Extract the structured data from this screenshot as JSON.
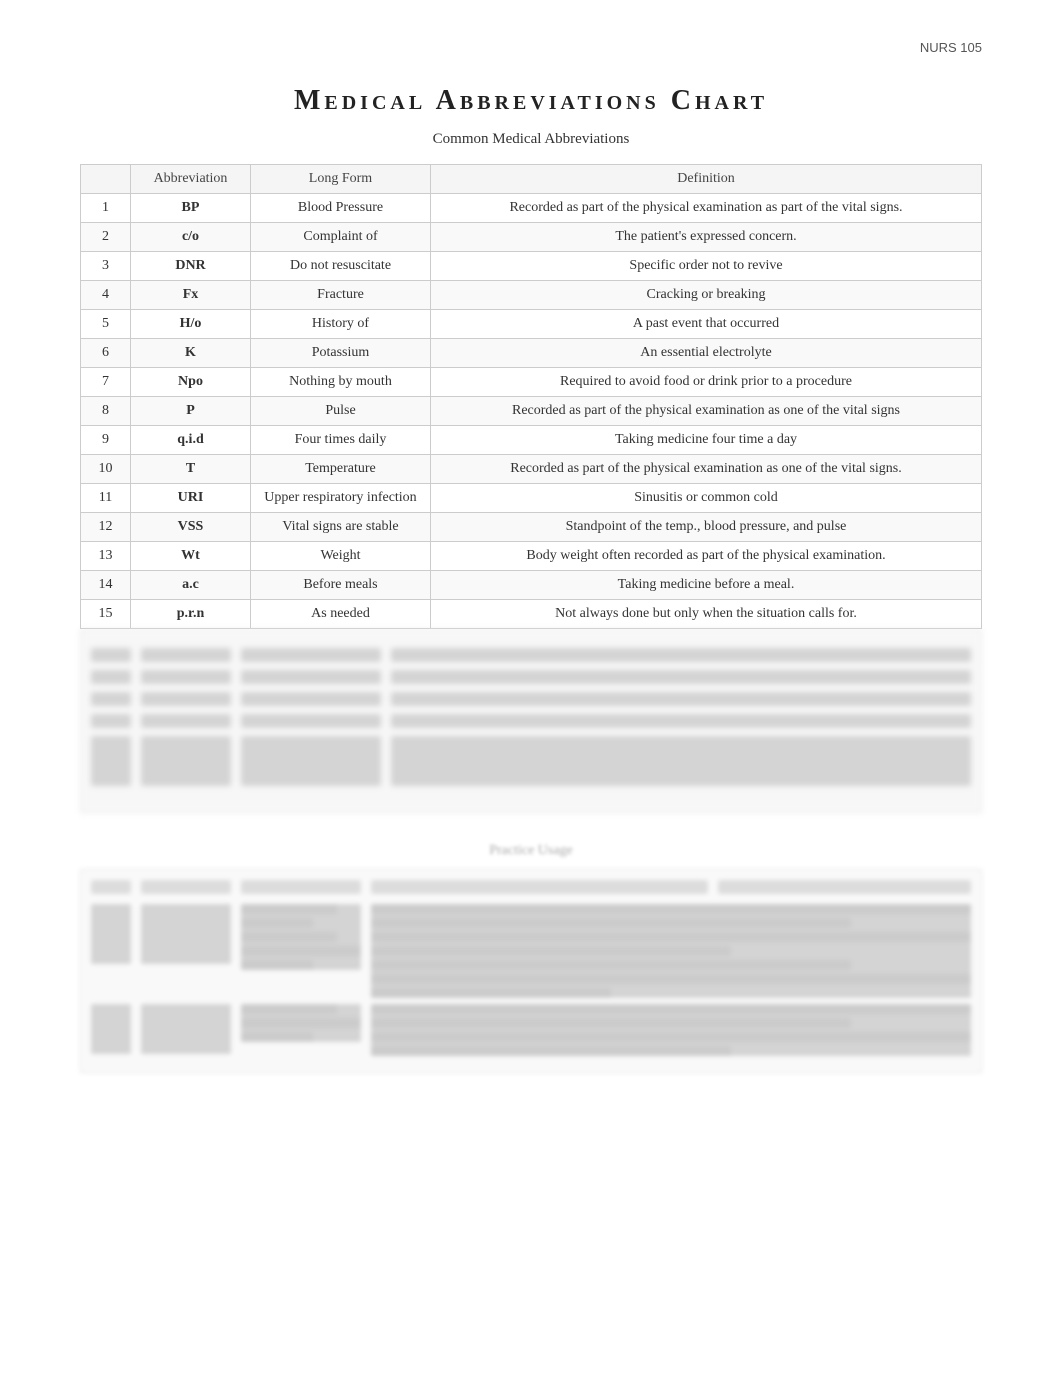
{
  "header": {
    "course": "NURS 105",
    "main_title": "Medical  Abbreviations   Chart",
    "subtitle": "Common Medical Abbreviations"
  },
  "table": {
    "columns": [
      "",
      "Abbreviation",
      "Long Form",
      "Definition"
    ],
    "rows": [
      {
        "num": "1",
        "abbr": "BP",
        "long": "Blood Pressure",
        "def": "Recorded as part of the physical examination as part of the vital signs."
      },
      {
        "num": "2",
        "abbr": "c/o",
        "long": "Complaint of",
        "def": "The patient's expressed concern."
      },
      {
        "num": "3",
        "abbr": "DNR",
        "long": "Do not resuscitate",
        "def": "Specific order not to revive"
      },
      {
        "num": "4",
        "abbr": "Fx",
        "long": "Fracture",
        "def": "Cracking or breaking"
      },
      {
        "num": "5",
        "abbr": "H/o",
        "long": "History of",
        "def": "A past event that occurred"
      },
      {
        "num": "6",
        "abbr": "K",
        "long": "Potassium",
        "def": "An essential electrolyte"
      },
      {
        "num": "7",
        "abbr": "Npo",
        "long": "Nothing by mouth",
        "def": "Required to avoid food or drink prior to a procedure"
      },
      {
        "num": "8",
        "abbr": "P",
        "long": "Pulse",
        "def": "Recorded as part of the physical examination as one of the vital signs"
      },
      {
        "num": "9",
        "abbr": "q.i.d",
        "long": "Four times daily",
        "def": "Taking medicine four time a day"
      },
      {
        "num": "10",
        "abbr": "T",
        "long": "Temperature",
        "def": "Recorded as part of the physical examination as one of the vital signs."
      },
      {
        "num": "11",
        "abbr": "URI",
        "long": "Upper respiratory infection",
        "def": "Sinusitis or common cold"
      },
      {
        "num": "12",
        "abbr": "VSS",
        "long": "Vital signs are stable",
        "def": "Standpoint of the temp., blood pressure, and pulse"
      },
      {
        "num": "13",
        "abbr": "Wt",
        "long": "Weight",
        "def": "Body weight often recorded as part of the physical examination."
      },
      {
        "num": "14",
        "abbr": "a.c",
        "long": "Before meals",
        "def": "Taking medicine before a meal."
      },
      {
        "num": "15",
        "abbr": "p.r.n",
        "long": "As needed",
        "def": "Not always done but only when the situation calls for."
      }
    ]
  }
}
